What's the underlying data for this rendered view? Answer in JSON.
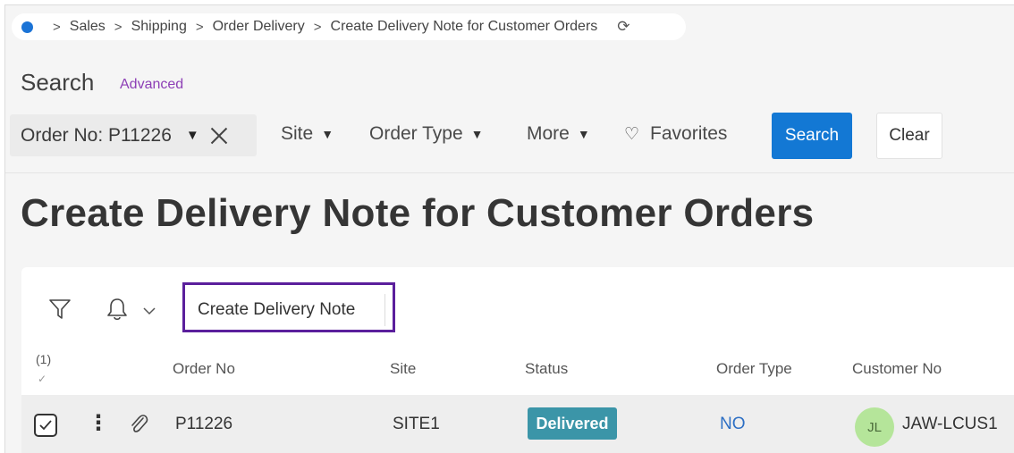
{
  "breadcrumb": {
    "items": [
      "Sales",
      "Shipping",
      "Order Delivery",
      "Create Delivery Note for Customer Orders"
    ],
    "separator": ">",
    "refresh_glyph": "⟳"
  },
  "search": {
    "title": "Search",
    "advanced_label": "Advanced",
    "active_filter": "Order No: P11226",
    "dropdowns": {
      "site": "Site",
      "order_type": "Order Type",
      "more": "More"
    },
    "favorites_label": "Favorites",
    "search_button": "Search",
    "clear_button": "Clear"
  },
  "page": {
    "title": "Create Delivery Note for Customer Orders"
  },
  "list": {
    "command_label": "Create Delivery Note",
    "selection_count": "(1)",
    "selection_check": "✓",
    "columns": {
      "order_no": "Order No",
      "site": "Site",
      "status": "Status",
      "order_type": "Order Type",
      "customer_no": "Customer No"
    },
    "rows": [
      {
        "order_no": "P11226",
        "site": "SITE1",
        "status": "Delivered",
        "order_type": "NO",
        "avatar_initials": "JL",
        "customer_no": "JAW-LCUS1",
        "selected": true
      }
    ]
  },
  "colors": {
    "primary": "#1378d4",
    "status_delivered": "#3b95a8",
    "highlight_border": "#5b1f9c",
    "advanced_link": "#8d3fb6",
    "avatar_bg": "#b5e59a"
  },
  "icons": {
    "filter": "funnel-icon",
    "bell": "bell-icon",
    "favorites": "heart-icon",
    "attachment": "paperclip-icon"
  }
}
